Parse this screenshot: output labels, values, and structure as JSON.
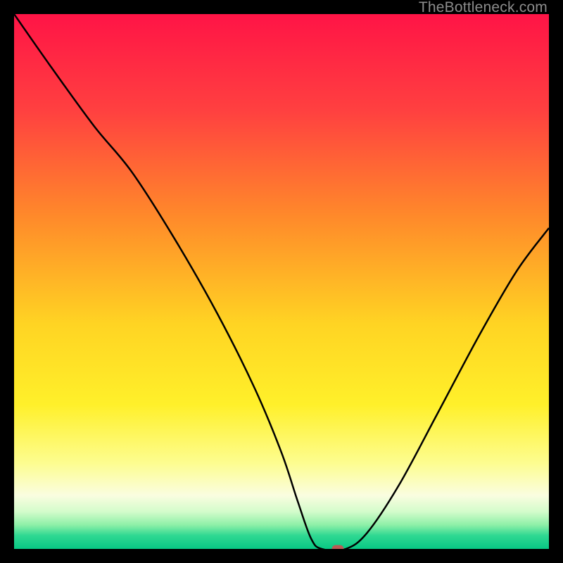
{
  "watermark": {
    "text": "TheBottleneck.com"
  },
  "colors": {
    "frame_bg": "#000000",
    "curve_stroke": "#000000",
    "marker_fill": "#bb5a55",
    "gradient_stops": [
      {
        "offset": 0,
        "color": "#ff1446"
      },
      {
        "offset": 0.18,
        "color": "#ff4040"
      },
      {
        "offset": 0.38,
        "color": "#ff8a2a"
      },
      {
        "offset": 0.58,
        "color": "#ffd423"
      },
      {
        "offset": 0.73,
        "color": "#fff02a"
      },
      {
        "offset": 0.84,
        "color": "#fdfd90"
      },
      {
        "offset": 0.9,
        "color": "#fafde0"
      },
      {
        "offset": 0.93,
        "color": "#d4fccb"
      },
      {
        "offset": 0.955,
        "color": "#8ef0a8"
      },
      {
        "offset": 0.975,
        "color": "#2fd892"
      },
      {
        "offset": 1.0,
        "color": "#08c884"
      }
    ]
  },
  "chart_data": {
    "type": "line",
    "title": "",
    "xlabel": "",
    "ylabel": "",
    "xlim": [
      0,
      100
    ],
    "ylim": [
      0,
      100
    ],
    "grid": false,
    "legend": false,
    "series": [
      {
        "name": "bottleneck-curve",
        "x": [
          0.0,
          7.0,
          15.0,
          22.0,
          30.0,
          38.0,
          45.0,
          50.0,
          53.0,
          55.5,
          57.5,
          62.0,
          66.0,
          72.0,
          79.0,
          87.0,
          94.0,
          100.0
        ],
        "y": [
          100.0,
          90.0,
          79.0,
          70.5,
          58.0,
          44.0,
          30.0,
          18.0,
          9.0,
          2.0,
          0.0,
          0.0,
          3.0,
          12.0,
          25.0,
          40.0,
          52.0,
          60.0
        ]
      }
    ],
    "marker": {
      "x": 60.5,
      "y": 0.0
    }
  }
}
